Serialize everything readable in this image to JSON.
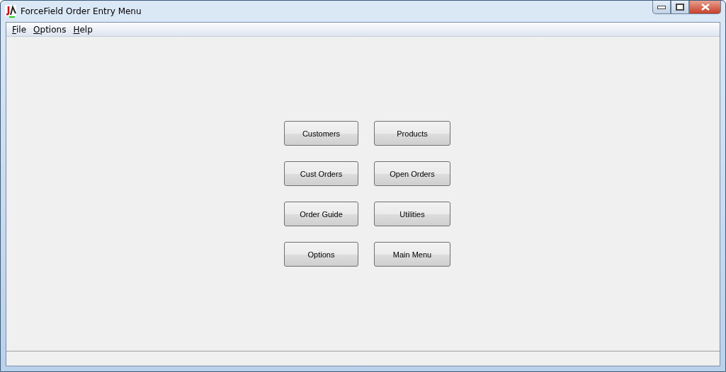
{
  "window": {
    "title": "ForceField Order Entry Menu"
  },
  "menu": [
    {
      "label": "File"
    },
    {
      "label": "Options"
    },
    {
      "label": "Help"
    }
  ],
  "buttons": [
    {
      "label": "Customers"
    },
    {
      "label": "Products"
    },
    {
      "label": "Cust Orders"
    },
    {
      "label": "Open Orders"
    },
    {
      "label": "Order Guide"
    },
    {
      "label": "Utilities"
    },
    {
      "label": "Options"
    },
    {
      "label": "Main Menu"
    }
  ]
}
